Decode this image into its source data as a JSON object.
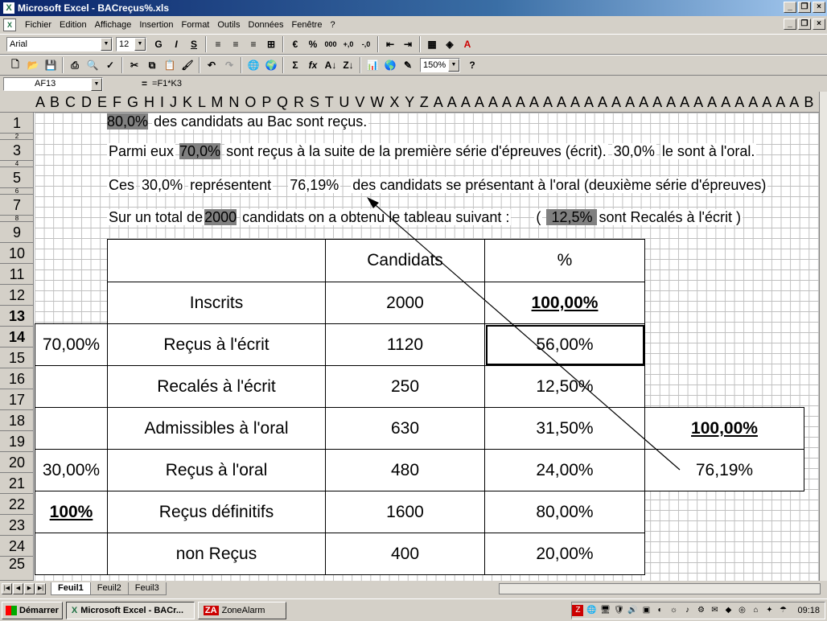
{
  "window": {
    "title": "Microsoft Excel - BACreçus%.xls"
  },
  "menu": [
    "Fichier",
    "Edition",
    "Affichage",
    "Insertion",
    "Format",
    "Outils",
    "Données",
    "Fenêtre",
    "?"
  ],
  "format_toolbar": {
    "font": "Arial",
    "size": "12",
    "bold": "G",
    "italic": "I",
    "underline": "S",
    "percent": "%",
    "thousands": "000"
  },
  "std_toolbar": {
    "sigma": "Σ",
    "fx": "fx",
    "zoom": "150%"
  },
  "formula_bar": {
    "name_box": "AF13",
    "equals": "=",
    "formula": "=F1*K3"
  },
  "column_headers": "A B C D E F G H I J K L M N O P Q R S T U V W X Y Z A A A A A A A A A A A A A A A A A A A A A A A A A A A B B E",
  "rows": [
    "1",
    "2",
    "3",
    "4",
    "5",
    "6",
    "7",
    "8",
    "9",
    "10",
    "11",
    "12",
    "13",
    "14",
    "15",
    "16",
    "17",
    "18",
    "19",
    "20",
    "21",
    "22",
    "23",
    "24",
    "25"
  ],
  "sheet": {
    "line1": {
      "pct": "80,0%",
      "text": "des candidats au Bac sont reçus."
    },
    "line3": {
      "lead": "Parmi eux",
      "pct": "70,0%",
      "text": "sont reçus à la suite de la première série d'épreuves (écrit).",
      "pct2": "30,0%",
      "tail": "le sont à l'oral."
    },
    "line5": {
      "lead": "Ces",
      "pct": "30,0%",
      "mid": "représentent",
      "pct2": "76,19%",
      "text": "des candidats se présentant à l'oral (deuxième série d'épreuves)"
    },
    "line7": {
      "lead": "Sur un total de",
      "total": "2000",
      "text": "candidats on a obtenu le tableau suivant :",
      "paren_open": "(",
      "pct": "12,5%",
      "tail": "sont Recalés à l'écrit )"
    }
  },
  "table": {
    "headers": {
      "candidats": "Candidats",
      "pct": "%"
    },
    "rows": [
      {
        "label": "Inscrits",
        "candidats": "2000",
        "pct": "100,00%"
      },
      {
        "label": "Reçus à l'écrit",
        "candidats": "1120",
        "pct": "56,00%"
      },
      {
        "label": "Recalés à l'écrit",
        "candidats": "250",
        "pct": "12,50%"
      },
      {
        "label": "Admissibles à l'oral",
        "candidats": "630",
        "pct": "31,50%"
      },
      {
        "label": "Reçus à l'oral",
        "candidats": "480",
        "pct": "24,00%"
      },
      {
        "label": "Reçus définitifs",
        "candidats": "1600",
        "pct": "80,00%"
      },
      {
        "label": "non Reçus",
        "candidats": "400",
        "pct": "20,00%"
      }
    ],
    "left": {
      "ecrit": "70,00%",
      "oral": "30,00%",
      "total": "100%"
    },
    "right": {
      "top": "100,00%",
      "bottom": "76,19%"
    }
  },
  "sheet_tabs": [
    "Feuil1",
    "Feuil2",
    "Feuil3"
  ],
  "taskbar": {
    "start": "Démarrer",
    "excel": "Microsoft Excel - BACr...",
    "zonealarm": "ZoneAlarm",
    "clock": "09:18"
  }
}
